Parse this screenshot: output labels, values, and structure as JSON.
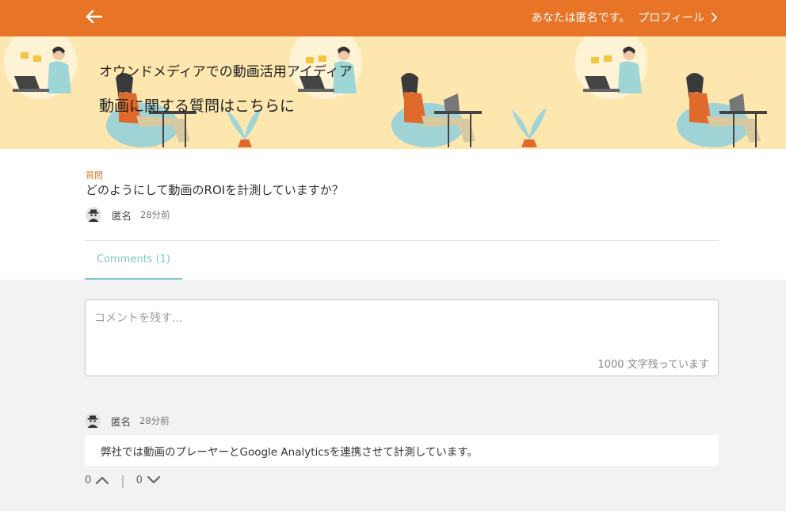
{
  "header": {
    "back_icon": "arrow-left-icon",
    "anonymous_message": "あなたは匿名です。",
    "profile_label": "プロフィール",
    "profile_icon": "chevron-right-icon",
    "accent_color": "#e87427"
  },
  "banner": {
    "subtitle": "オウンドメディアでの動画活用アイディア",
    "title": "動画に関する質問はこちらに",
    "background_color": "#fde7ae"
  },
  "question": {
    "label": "質問",
    "text": "どのようにして動画のROIを計測していますか？",
    "author": "匿名",
    "time": "28分前"
  },
  "tabs": [
    {
      "label": "Comments (1)",
      "active": true
    }
  ],
  "comment_form": {
    "placeholder": "コメントを残す...",
    "value": "",
    "char_count": "1000 文字残っています"
  },
  "comments": [
    {
      "author": "匿名",
      "time": "28分前",
      "text": "弊社では動画のプレーヤーとGoogle Analyticsを連携させて計測しています。",
      "upvotes": "0",
      "downvotes": "0",
      "separator": "|"
    }
  ]
}
